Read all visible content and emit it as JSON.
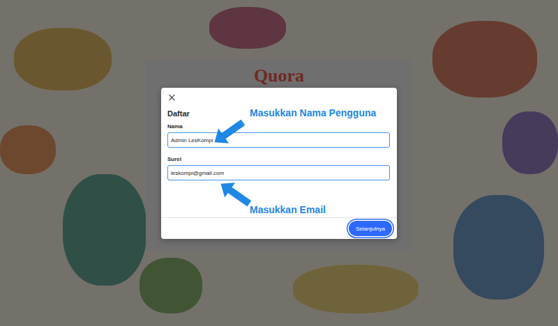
{
  "background": {
    "logo": "Quora"
  },
  "modal": {
    "close": "×",
    "title": "Daftar",
    "fields": [
      {
        "label": "Nama",
        "value": "Admin LesKompi"
      },
      {
        "label": "Surel",
        "value": "leskompi@gmail.com"
      }
    ],
    "button": "Selanjutnya"
  },
  "annotations": [
    {
      "text": "Masukkan Nama Pengguna"
    },
    {
      "text": "Masukkan Email"
    }
  ]
}
